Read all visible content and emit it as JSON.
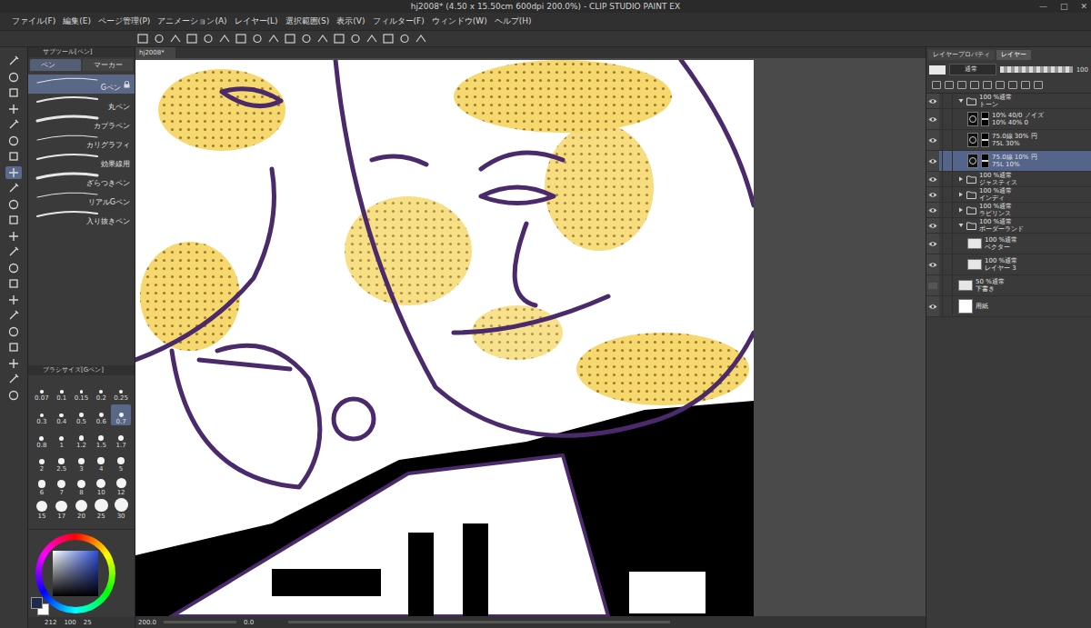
{
  "window": {
    "title": "hj2008* (4.50 x 15.50cm 600dpi 200.0%) - CLIP STUDIO PAINT EX",
    "controls": [
      "—",
      "□",
      "✕"
    ]
  },
  "menu": [
    "ファイル(F)",
    "編集(E)",
    "ページ管理(P)",
    "アニメーション(A)",
    "レイヤー(L)",
    "選択範囲(S)",
    "表示(V)",
    "フィルター(F)",
    "ウィンドウ(W)",
    "ヘルプ(H)"
  ],
  "tools": [
    {
      "selected": false
    },
    {
      "selected": false
    },
    {
      "selected": false
    },
    {
      "selected": false
    },
    {
      "selected": false
    },
    {
      "selected": false
    },
    {
      "selected": false
    },
    {
      "selected": true
    },
    {
      "selected": false
    },
    {
      "selected": false
    },
    {
      "selected": false
    },
    {
      "selected": false
    },
    {
      "selected": false
    },
    {
      "selected": false
    },
    {
      "selected": false
    },
    {
      "selected": false
    },
    {
      "selected": false
    },
    {
      "selected": false
    },
    {
      "selected": false
    },
    {
      "selected": false
    },
    {
      "selected": false
    },
    {
      "selected": false
    }
  ],
  "sub_tool": {
    "title": "サブツール[ペン]",
    "tabs": [
      {
        "label": "ペン",
        "selected": true
      },
      {
        "label": "マーカー",
        "selected": false
      }
    ],
    "items": [
      {
        "label": "Gペン",
        "selected": true,
        "locked": true
      },
      {
        "label": "丸ペン",
        "selected": false,
        "locked": false
      },
      {
        "label": "カブラペン",
        "selected": false,
        "locked": false
      },
      {
        "label": "カリグラフィ",
        "selected": false,
        "locked": false
      },
      {
        "label": "効果線用",
        "selected": false,
        "locked": false
      },
      {
        "label": "ざらつきペン",
        "selected": false,
        "locked": false
      },
      {
        "label": "リアルGペン",
        "selected": false,
        "locked": false
      },
      {
        "label": "入り抜きペン",
        "selected": false,
        "locked": false
      }
    ]
  },
  "brush_size": {
    "title": "ブラシサイズ[Gペン]",
    "sizes": [
      {
        "label": "0.07",
        "selected": false
      },
      {
        "label": "0.1",
        "selected": false
      },
      {
        "label": "0.15",
        "selected": false
      },
      {
        "label": "0.2",
        "selected": false
      },
      {
        "label": "0.25",
        "selected": false
      },
      {
        "label": "0.3",
        "selected": false
      },
      {
        "label": "0.4",
        "selected": false
      },
      {
        "label": "0.5",
        "selected": false
      },
      {
        "label": "0.6",
        "selected": false
      },
      {
        "label": "0.7",
        "selected": true
      },
      {
        "label": "0.8",
        "selected": false
      },
      {
        "label": "1",
        "selected": false
      },
      {
        "label": "1.2",
        "selected": false
      },
      {
        "label": "1.5",
        "selected": false
      },
      {
        "label": "1.7",
        "selected": false
      },
      {
        "label": "2",
        "selected": false
      },
      {
        "label": "2.5",
        "selected": false
      },
      {
        "label": "3",
        "selected": false
      },
      {
        "label": "4",
        "selected": false
      },
      {
        "label": "5",
        "selected": false
      },
      {
        "label": "6",
        "selected": false
      },
      {
        "label": "7",
        "selected": false
      },
      {
        "label": "8",
        "selected": false
      },
      {
        "label": "10",
        "selected": false
      },
      {
        "label": "12",
        "selected": false
      },
      {
        "label": "15",
        "selected": false
      },
      {
        "label": "17",
        "selected": false
      },
      {
        "label": "20",
        "selected": false
      },
      {
        "label": "25",
        "selected": false
      },
      {
        "label": "30",
        "selected": false
      }
    ]
  },
  "color": {
    "main": "#1c2a4c",
    "sub": "#ffffff",
    "readings": [
      "212",
      "100",
      "25"
    ]
  },
  "document_tab": {
    "label": "hj2008*"
  },
  "status_bar": {
    "zoom": "200.0",
    "angle": "0.0"
  },
  "layer_panel": {
    "tabs": [
      {
        "label": "レイヤープロパティ",
        "selected": false
      },
      {
        "label": "レイヤー",
        "selected": true
      }
    ],
    "blend_mode": "通常",
    "opacity": "100",
    "layers": [
      {
        "kind": "folder",
        "mode": "100 %通常",
        "name": "トーン",
        "visible": true,
        "expanded": true,
        "depth": 0,
        "selected": false
      },
      {
        "kind": "tone",
        "mode": "10% 40/0 ノイズ",
        "name": "10% 40% 0",
        "visible": true,
        "depth": 1,
        "selected": false
      },
      {
        "kind": "tone",
        "mode": "75.0線 30% 円",
        "name": "75L 30%",
        "visible": true,
        "depth": 1,
        "selected": false
      },
      {
        "kind": "tone",
        "mode": "75.0線 10% 円",
        "name": "75L 10%",
        "visible": true,
        "depth": 1,
        "selected": true
      },
      {
        "kind": "folder",
        "mode": "100 %通常",
        "name": "ジャスティス",
        "visible": true,
        "expanded": false,
        "depth": 0,
        "selected": false
      },
      {
        "kind": "folder",
        "mode": "100 %通常",
        "name": "インディ",
        "visible": true,
        "expanded": false,
        "depth": 0,
        "selected": false
      },
      {
        "kind": "folder",
        "mode": "100 %通常",
        "name": "ラビリンス",
        "visible": true,
        "expanded": false,
        "depth": 0,
        "selected": false
      },
      {
        "kind": "folder",
        "mode": "100 %通常",
        "name": "ボーダーランド",
        "visible": true,
        "expanded": true,
        "depth": 0,
        "selected": false
      },
      {
        "kind": "vector",
        "mode": "100 %通常",
        "name": "ベクター",
        "visible": true,
        "depth": 1,
        "selected": false
      },
      {
        "kind": "raster",
        "mode": "100 %通常",
        "name": "レイヤー 3",
        "visible": true,
        "depth": 1,
        "selected": false
      },
      {
        "kind": "raster",
        "mode": "50 %通常",
        "name": "下書き",
        "visible": false,
        "depth": 0,
        "selected": false
      },
      {
        "kind": "paper",
        "name": "用紙",
        "visible": true,
        "depth": 0,
        "selected": false
      }
    ]
  }
}
